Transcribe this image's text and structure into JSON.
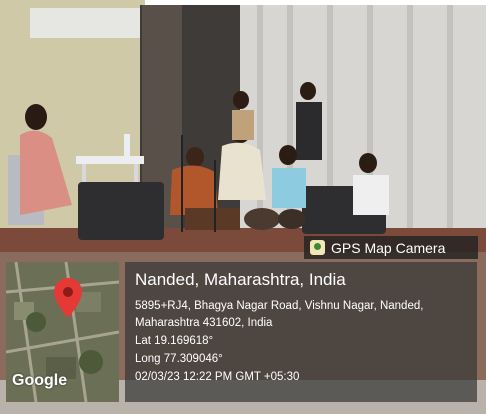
{
  "badge": {
    "label": "GPS Map Camera",
    "icon": "gps-map-camera-icon"
  },
  "location": {
    "city": "Nanded, Maharashtra, India",
    "address_line1": "5895+RJ4, Bhagya Nagar Road, Vishnu Nagar, Nanded,",
    "address_line2": "Maharashtra 431602, India",
    "lat": "Lat 19.169618°",
    "long": "Long 77.309046°",
    "datetime": "02/03/23 12:22 PM GMT +05:30"
  },
  "map": {
    "brand": "Google",
    "pin_color": "#e53935"
  }
}
